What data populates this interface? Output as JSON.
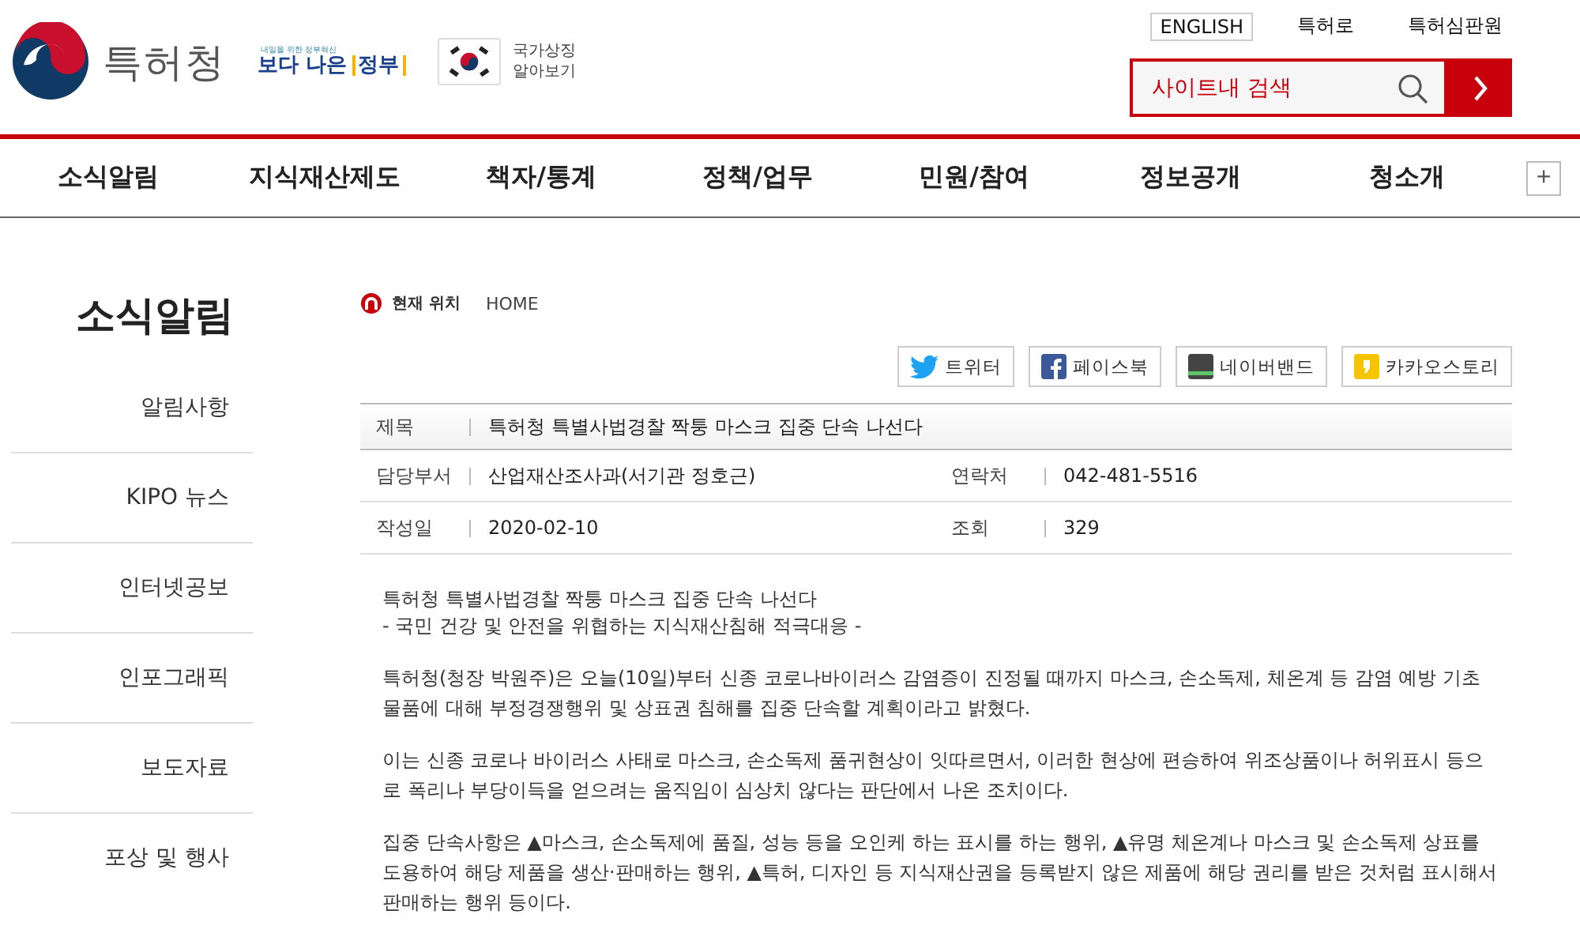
{
  "header": {
    "logo_text": "특허청",
    "campaign": {
      "tagline": "내일을 위한 정부혁신",
      "main": "보다 나은",
      "accent": "정부"
    },
    "symbol_link": [
      "국가상징",
      "알아보기"
    ],
    "util_links": [
      {
        "label": "ENGLISH",
        "kind": "boxed"
      },
      {
        "label": "특허로",
        "kind": "plain"
      },
      {
        "label": "특허심판원",
        "kind": "plain"
      }
    ],
    "search": {
      "placeholder": "사이트내 검색"
    }
  },
  "nav": {
    "items": [
      "소식알림",
      "지식재산제도",
      "책자/통계",
      "정책/업무",
      "민원/참여",
      "정보공개",
      "청소개"
    ],
    "more": "+"
  },
  "sidebar": {
    "title": "소식알림",
    "items": [
      "알림사항",
      "KIPO 뉴스",
      "인터넷공보",
      "인포그래픽",
      "보도자료",
      "포상 및 행사"
    ]
  },
  "breadcrumb": {
    "label": "현재 위치",
    "path": "HOME"
  },
  "share": [
    {
      "kind": "twitter",
      "label": "트위터"
    },
    {
      "kind": "facebook",
      "label": "페이스북"
    },
    {
      "kind": "band",
      "label": "네이버밴드"
    },
    {
      "kind": "kakao",
      "label": "카카오스토리"
    }
  ],
  "article": {
    "fields": [
      [
        {
          "label": "제목",
          "value": "특허청 특별사법경찰 짝퉁 마스크 집중 단속 나선다"
        }
      ],
      [
        {
          "label": "담당부서",
          "value": "산업재산조사과(서기관 정호근)"
        },
        {
          "label": "연락처",
          "value": "042-481-5516"
        }
      ],
      [
        {
          "label": "작성일",
          "value": "2020-02-10"
        },
        {
          "label": "조회",
          "value": "329"
        }
      ]
    ],
    "heading": "특허청 특별사법경찰 짝퉁 마스크 집중 단속 나선다",
    "subheading": "- 국민 건강 및 안전을 위협하는 지식재산침해 적극대응  -",
    "paragraphs": [
      "특허청(청장 박원주)은 오늘(10일)부터 신종 코로나바이러스 감염증이 진정될 때까지 마스크, 손소독제, 체온계 등 감염 예방 기초 물품에 대해 부정경쟁행위 및 상표권 침해를 집중 단속할 계획이라고 밝혔다.",
      "이는 신종 코로나 바이러스 사태로 마스크, 손소독제 품귀현상이 잇따르면서, 이러한 현상에 편승하여 위조상품이나 허위표시 등으로 폭리나 부당이득을 얻으려는 움직임이 심상치 않다는 판단에서 나온 조치이다.",
      "집중 단속사항은 ▲마스크, 손소독제에 품질, 성능 등을 오인케 하는 표시를 하는 행위, ▲유명 체온계나 마스크 및 손소독제 상표를 도용하여 해당 제품을 생산·판매하는 행위, ▲특허, 디자인 등 지식재산권을 등록받지 않은 제품에 해당 권리를 받은 것처럼 표시해서 판매하는 행위 등이다."
    ]
  }
}
